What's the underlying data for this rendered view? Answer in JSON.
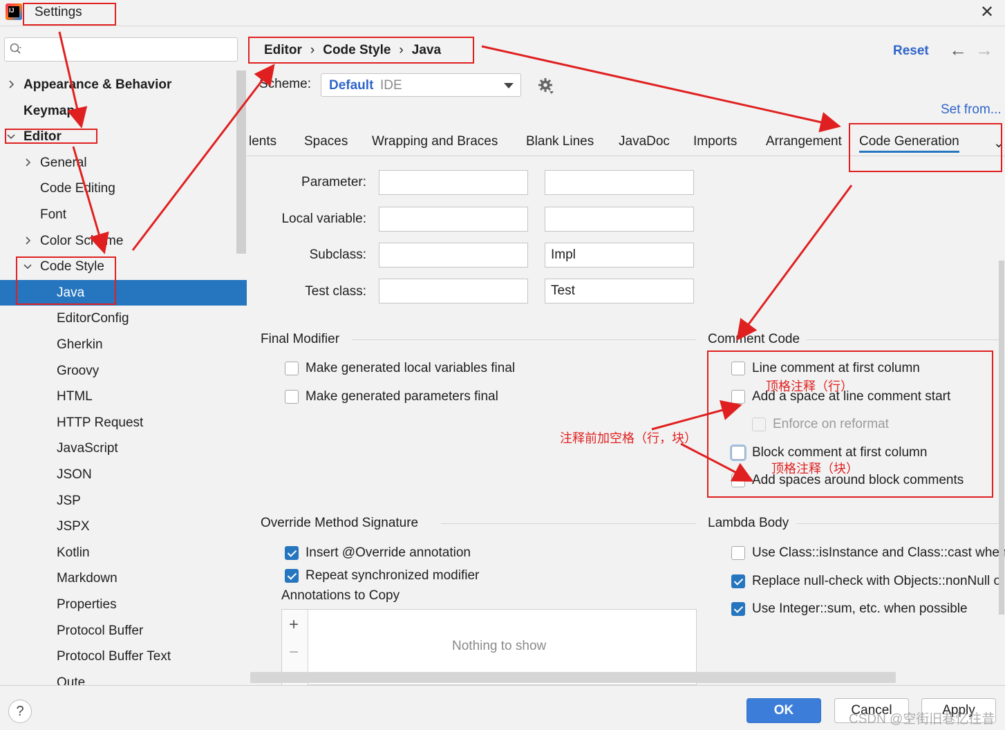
{
  "window": {
    "title": "Settings",
    "close_glyph": "✕"
  },
  "search": {
    "placeholder": ""
  },
  "sidebar": {
    "items": [
      {
        "label": "Appearance & Behavior",
        "bold": true,
        "chevron": "right"
      },
      {
        "label": "Keymap",
        "bold": true,
        "chevron": "none"
      },
      {
        "label": "Editor",
        "bold": true,
        "chevron": "down"
      },
      {
        "label": "General",
        "bold": false,
        "chevron": "right"
      },
      {
        "label": "Code Editing",
        "bold": false,
        "chevron": "none"
      },
      {
        "label": "Font",
        "bold": false,
        "chevron": "none"
      },
      {
        "label": "Color Scheme",
        "bold": false,
        "chevron": "right"
      },
      {
        "label": "Code Style",
        "bold": false,
        "chevron": "down"
      },
      {
        "label": "Java",
        "bold": false,
        "chevron": "none",
        "selected": true
      },
      {
        "label": "EditorConfig",
        "bold": false,
        "chevron": "none"
      },
      {
        "label": "Gherkin",
        "bold": false,
        "chevron": "none"
      },
      {
        "label": "Groovy",
        "bold": false,
        "chevron": "none"
      },
      {
        "label": "HTML",
        "bold": false,
        "chevron": "none"
      },
      {
        "label": "HTTP Request",
        "bold": false,
        "chevron": "none"
      },
      {
        "label": "JavaScript",
        "bold": false,
        "chevron": "none"
      },
      {
        "label": "JSON",
        "bold": false,
        "chevron": "none"
      },
      {
        "label": "JSP",
        "bold": false,
        "chevron": "none"
      },
      {
        "label": "JSPX",
        "bold": false,
        "chevron": "none"
      },
      {
        "label": "Kotlin",
        "bold": false,
        "chevron": "none"
      },
      {
        "label": "Markdown",
        "bold": false,
        "chevron": "none"
      },
      {
        "label": "Properties",
        "bold": false,
        "chevron": "none"
      },
      {
        "label": "Protocol Buffer",
        "bold": false,
        "chevron": "none"
      },
      {
        "label": "Protocol Buffer Text",
        "bold": false,
        "chevron": "none"
      },
      {
        "label": "Qute",
        "bold": false,
        "chevron": "none"
      }
    ]
  },
  "breadcrumb": {
    "items": [
      "Editor",
      "Code Style",
      "Java"
    ],
    "separator": "›"
  },
  "header": {
    "reset": "Reset",
    "back_glyph": "←",
    "forward_glyph": "→"
  },
  "scheme": {
    "label": "Scheme:",
    "value": "Default",
    "suffix": "IDE",
    "set_from": "Set from..."
  },
  "tabs": [
    {
      "label": "lents",
      "active": false
    },
    {
      "label": "Spaces",
      "active": false
    },
    {
      "label": "Wrapping and Braces",
      "active": false
    },
    {
      "label": "Blank Lines",
      "active": false
    },
    {
      "label": "JavaDoc",
      "active": false
    },
    {
      "label": "Imports",
      "active": false
    },
    {
      "label": "Arrangement",
      "active": false
    },
    {
      "label": "Code Generation",
      "active": true
    }
  ],
  "tab_more_glyph": "⌄",
  "naming": {
    "rows": [
      {
        "label": "Parameter:",
        "prefix": "",
        "suffix": ""
      },
      {
        "label": "Local variable:",
        "prefix": "",
        "suffix": ""
      },
      {
        "label": "Subclass:",
        "prefix": "",
        "suffix": "Impl"
      },
      {
        "label": "Test class:",
        "prefix": "",
        "suffix": "Test"
      }
    ]
  },
  "final_modifier": {
    "title": "Final Modifier",
    "options": [
      {
        "label": "Make generated local variables final",
        "checked": false
      },
      {
        "label": "Make generated parameters final",
        "checked": false
      }
    ]
  },
  "comment_code": {
    "title": "Comment Code",
    "options": [
      {
        "label": "Line comment at first column",
        "checked": false
      },
      {
        "label": "Add a space at line comment start",
        "checked": false
      },
      {
        "label": "Enforce on reformat",
        "checked": false,
        "disabled": true
      },
      {
        "label": "Block comment at first column",
        "checked": false,
        "focused": true
      },
      {
        "label": "Add spaces around block comments",
        "checked": false
      }
    ]
  },
  "override": {
    "title": "Override Method Signature",
    "options": [
      {
        "label": "Insert @Override annotation",
        "checked": true
      },
      {
        "label": "Repeat synchronized modifier",
        "checked": true
      }
    ],
    "annotations_label": "Annotations to Copy",
    "add_glyph": "+",
    "remove_glyph": "−",
    "empty_text": "Nothing to show"
  },
  "lambda": {
    "title": "Lambda Body",
    "options": [
      {
        "label": "Use Class::isInstance and Class::cast when p",
        "checked": false
      },
      {
        "label": "Replace null-check with Objects::nonNull o",
        "checked": true
      },
      {
        "label": "Use Integer::sum, etc. when possible",
        "checked": true
      }
    ]
  },
  "footer": {
    "help": "?",
    "ok": "OK",
    "cancel": "Cancel",
    "apply": "Apply",
    "watermark": "CSDN @空街旧巷忆往昔"
  },
  "annotations": {
    "note_line": "顶格注释（行）",
    "note_space": "注释前加空格（行，块）",
    "note_block": "顶格注释（块）"
  },
  "colors": {
    "accent": "#2675bf",
    "link": "#2f65ca",
    "annotation": "#e02020"
  }
}
